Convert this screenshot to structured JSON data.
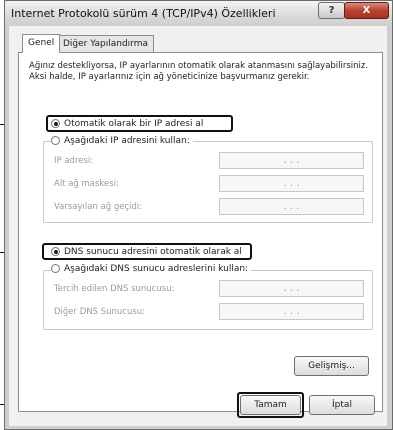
{
  "window": {
    "title": "Internet Protokolü sürüm 4 (TCP/IPv4) Özellikleri",
    "help_label": "?",
    "close_label": "X"
  },
  "tabs": [
    {
      "label": "Genel",
      "active": true
    },
    {
      "label": "Diğer Yapılandırma",
      "active": false
    }
  ],
  "description": "Ağınız destekliyorsa, IP ayarlarının otomatik olarak atanmasını sağlayabilirsiniz. Aksi halde, IP ayarlarınız için ağ yöneticinize başvurmanız gerekir.",
  "ip": {
    "auto_label": "Otomatik olarak bir IP adresi al",
    "manual_label": "Aşağıdaki IP adresini kullan:",
    "fields": [
      {
        "label": "IP adresi:",
        "value": ". . ."
      },
      {
        "label": "Alt ağ maskesi:",
        "value": ". . ."
      },
      {
        "label": "Varsayılan ağ geçidi:",
        "value": ". . ."
      }
    ]
  },
  "dns": {
    "auto_label": "DNS sunucu adresini otomatik olarak al",
    "manual_label": "Aşağıdaki DNS sunucu adreslerini kullan:",
    "fields": [
      {
        "label": "Tercih edilen DNS sunucusu:",
        "value": ". . ."
      },
      {
        "label": "Diğer DNS Sunucusu:",
        "value": ". . ."
      }
    ]
  },
  "buttons": {
    "advanced": "Gelişmiş...",
    "ok": "Tamam",
    "cancel": "İptal"
  }
}
